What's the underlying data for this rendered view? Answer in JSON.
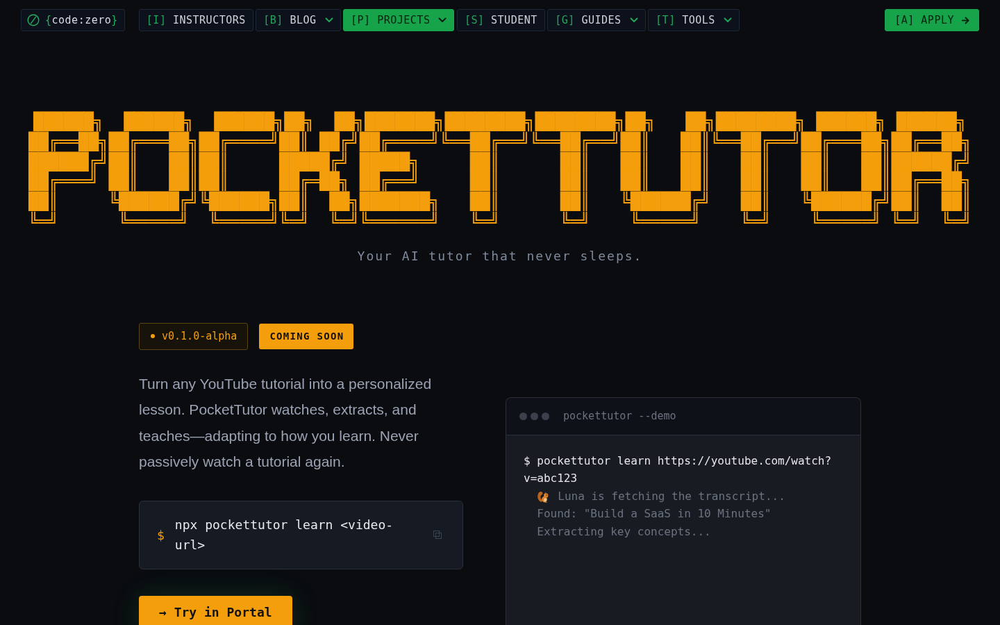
{
  "nav": {
    "brand": {
      "open": "{",
      "name": "code:zero",
      "close": "}"
    },
    "items": [
      {
        "key": "[I]",
        "label": "INSTRUCTORS",
        "has_menu": false,
        "selected": false
      },
      {
        "key": "[B]",
        "label": "BLOG",
        "has_menu": true,
        "selected": false
      },
      {
        "key": "[P]",
        "label": "PROJECTS",
        "has_menu": true,
        "selected": true
      },
      {
        "key": "[S]",
        "label": "STUDENT",
        "has_menu": false,
        "selected": false
      },
      {
        "key": "[G]",
        "label": "GUIDES",
        "has_menu": true,
        "selected": false
      },
      {
        "key": "[T]",
        "label": "TOOLS",
        "has_menu": true,
        "selected": false
      }
    ],
    "cta": {
      "key": "[A]",
      "label": "APPLY"
    }
  },
  "hero": {
    "ascii_title": [
      "██████╗  ██████╗  ██████╗██╗  ██╗███████╗████████╗████████╗██╗   ██╗████████╗ ██████╗ ██████╗",
      "██╔══██╗██╔═══██╗██╔════╝██║ ██╔╝██╔════╝╚══██╔══╝╚══██╔══╝██║   ██║╚══██╔══╝██╔═══██╗██╔══██╗",
      "██████╔╝██║   ██║██║     █████╔╝ █████╗     ██║      ██║   ██║   ██║   ██║   ██║   ██║██████╔╝",
      "██╔═══╝ ██║   ██║██║     ██╔═██╗ ██╔══╝     ██║      ██║   ██║   ██║   ██║   ██║   ██║██╔══██╗",
      "██║     ╚██████╔╝╚██████╗██║  ██╗███████╗   ██║      ██║   ╚██████╔╝   ██║   ╚██████╔╝██║  ██║",
      "╚═╝      ╚═════╝  ╚═════╝╚═╝  ╚═╝╚══════╝   ╚═╝      ╚═╝    ╚═════╝    ╚═╝    ╚═════╝ ╚═╝  ╚═╝"
    ],
    "tagline": "Your AI tutor that never sleeps."
  },
  "badges": [
    {
      "kind": "version",
      "label": "v0.1.0-alpha"
    },
    {
      "kind": "status",
      "label": "COMING SOON"
    }
  ],
  "description": "Turn any YouTube tutorial into a personalized lesson. PocketTutor watches, extracts, and teaches—adapting to how you learn. Never passively watch a tutorial again.",
  "install": {
    "prompt": "$",
    "command": "npx pockettutor learn <video-url>"
  },
  "cta_button": "→ Try in Portal",
  "terminal": {
    "title": "pockettutor --demo",
    "lines": [
      {
        "kind": "command",
        "text": "$ pockettutor learn https://youtube.com/watch?v=abc123"
      },
      {
        "kind": "status",
        "text": "Luna is fetching the transcript..."
      },
      {
        "kind": "output",
        "text": "Found: \"Build a SaaS in 10 Minutes\""
      },
      {
        "kind": "output",
        "text": "Extracting key concepts..."
      }
    ]
  }
}
